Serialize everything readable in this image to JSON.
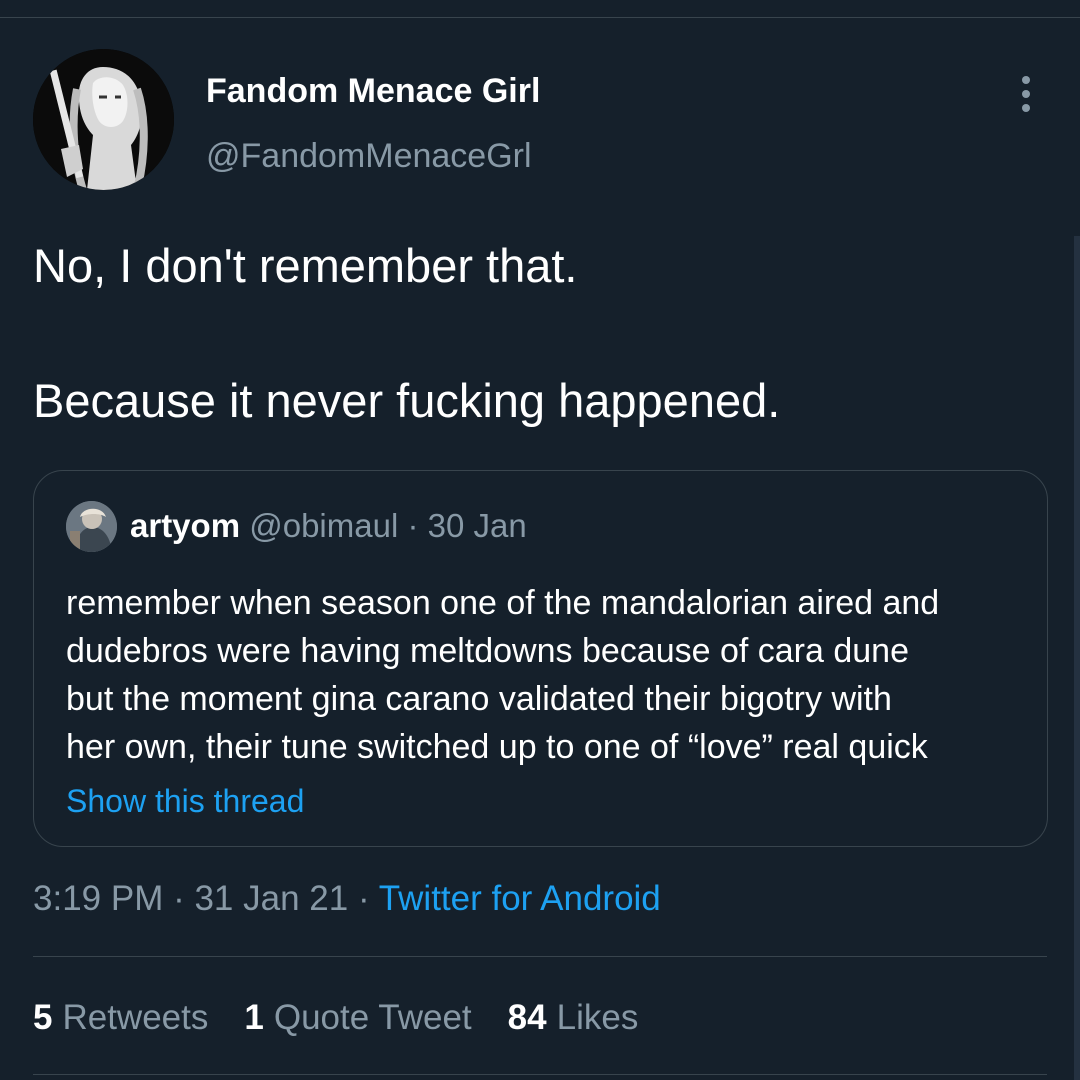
{
  "tweet": {
    "author": {
      "display_name": "Fandom Menace Girl",
      "handle": "@FandomMenaceGrl"
    },
    "text_lines": [
      "No, I don't remember that.",
      "Because it never fucking happened."
    ],
    "quoted": {
      "name": "artyom",
      "handle": "@obimaul",
      "date": "30 Jan",
      "body_lines": [
        "remember when season one of the mandalorian aired and",
        "dudebros were having meltdowns because of cara dune",
        "but the moment gina carano validated their bigotry with",
        "her own, their tune switched up to one of “love” real quick"
      ],
      "show_thread_label": "Show this thread"
    },
    "time": "3:19 PM",
    "date": "31 Jan 21",
    "source": "Twitter for Android",
    "separator": " · ",
    "stats": {
      "retweets_count": "5",
      "retweets_label": "Retweets",
      "quotes_count": "1",
      "quotes_label": "Quote Tweet",
      "likes_count": "84",
      "likes_label": "Likes"
    }
  },
  "icons": {
    "more": "more-vertical-icon"
  },
  "colors": {
    "background": "#15202b",
    "text_primary": "#ffffff",
    "text_secondary": "#8899a6",
    "link": "#1da1f2",
    "border": "#38444d"
  }
}
